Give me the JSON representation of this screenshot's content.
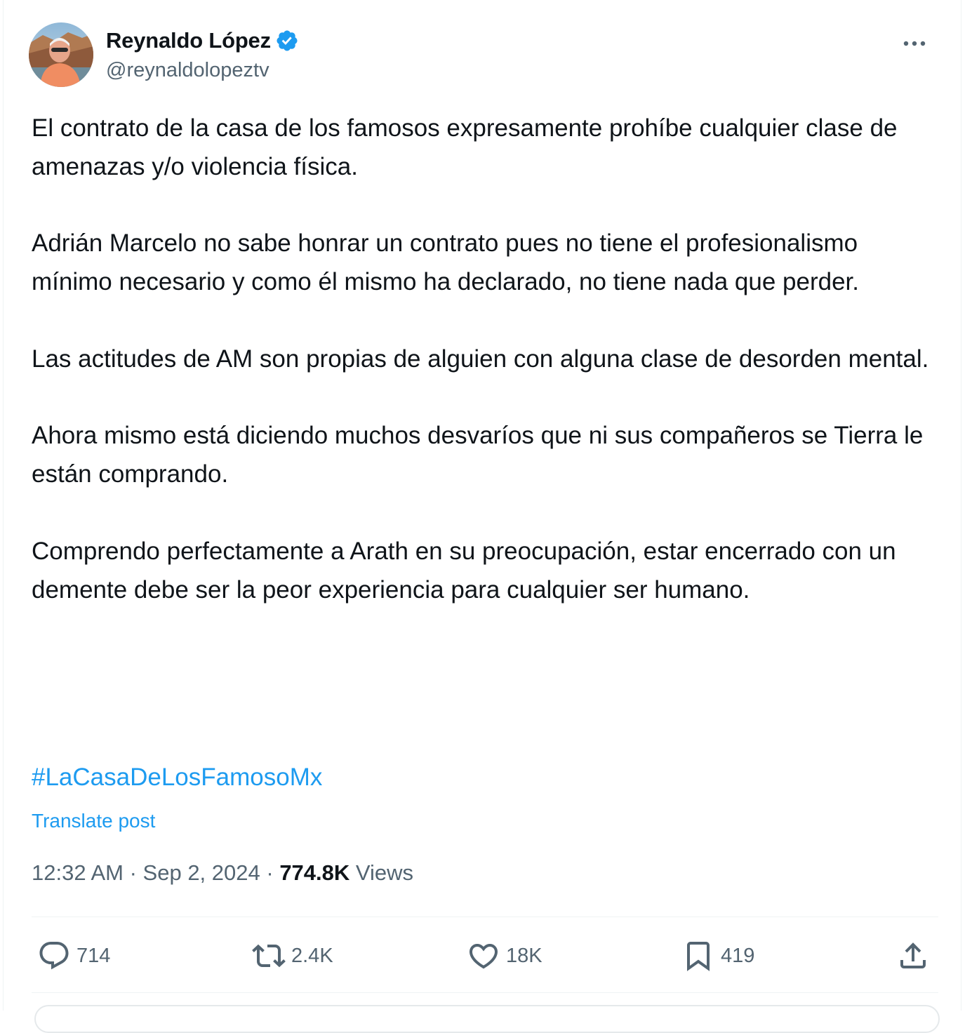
{
  "author": {
    "name": "Reynaldo López",
    "handle": "@reynaldolopeztv",
    "verified_color": "#1d9bf0"
  },
  "icons": {
    "more": "more-horizontal-icon",
    "verified": "verified-badge-icon",
    "reply": "reply-icon",
    "repost": "repost-icon",
    "like": "heart-icon",
    "bookmark": "bookmark-icon",
    "share": "share-icon"
  },
  "post": {
    "paragraphs": [
      "El contrato de la casa de los famosos expresamente prohíbe cualquier clase de amenazas y/o violencia física.",
      "Adrián Marcelo no sabe honrar un contrato pues no tiene el profesionalismo mínimo necesario y como él mismo ha declarado, no tiene nada que perder.",
      "Las actitudes de AM son propias de alguien con alguna clase de desorden mental.",
      "Ahora mismo está diciendo muchos desvaríos que ni sus compañeros se Tierra le están comprando.",
      "Comprendo perfectamente a Arath en su preocupación, estar encerrado con un demente debe ser la peor experiencia para cualquier ser humano."
    ],
    "hashtag": "#LaCasaDeLosFamosoMx",
    "translate_label": "Translate post"
  },
  "meta": {
    "time": "12:32 AM",
    "separator": " · ",
    "date": "Sep 2, 2024",
    "views_count": "774.8K",
    "views_label": " Views"
  },
  "actions": {
    "replies": "714",
    "reposts": "2.4K",
    "likes": "18K",
    "bookmarks": "419"
  },
  "colors": {
    "text": "#0f1419",
    "secondary": "#536471",
    "link": "#1d9bf0",
    "border": "#eff3f4"
  }
}
